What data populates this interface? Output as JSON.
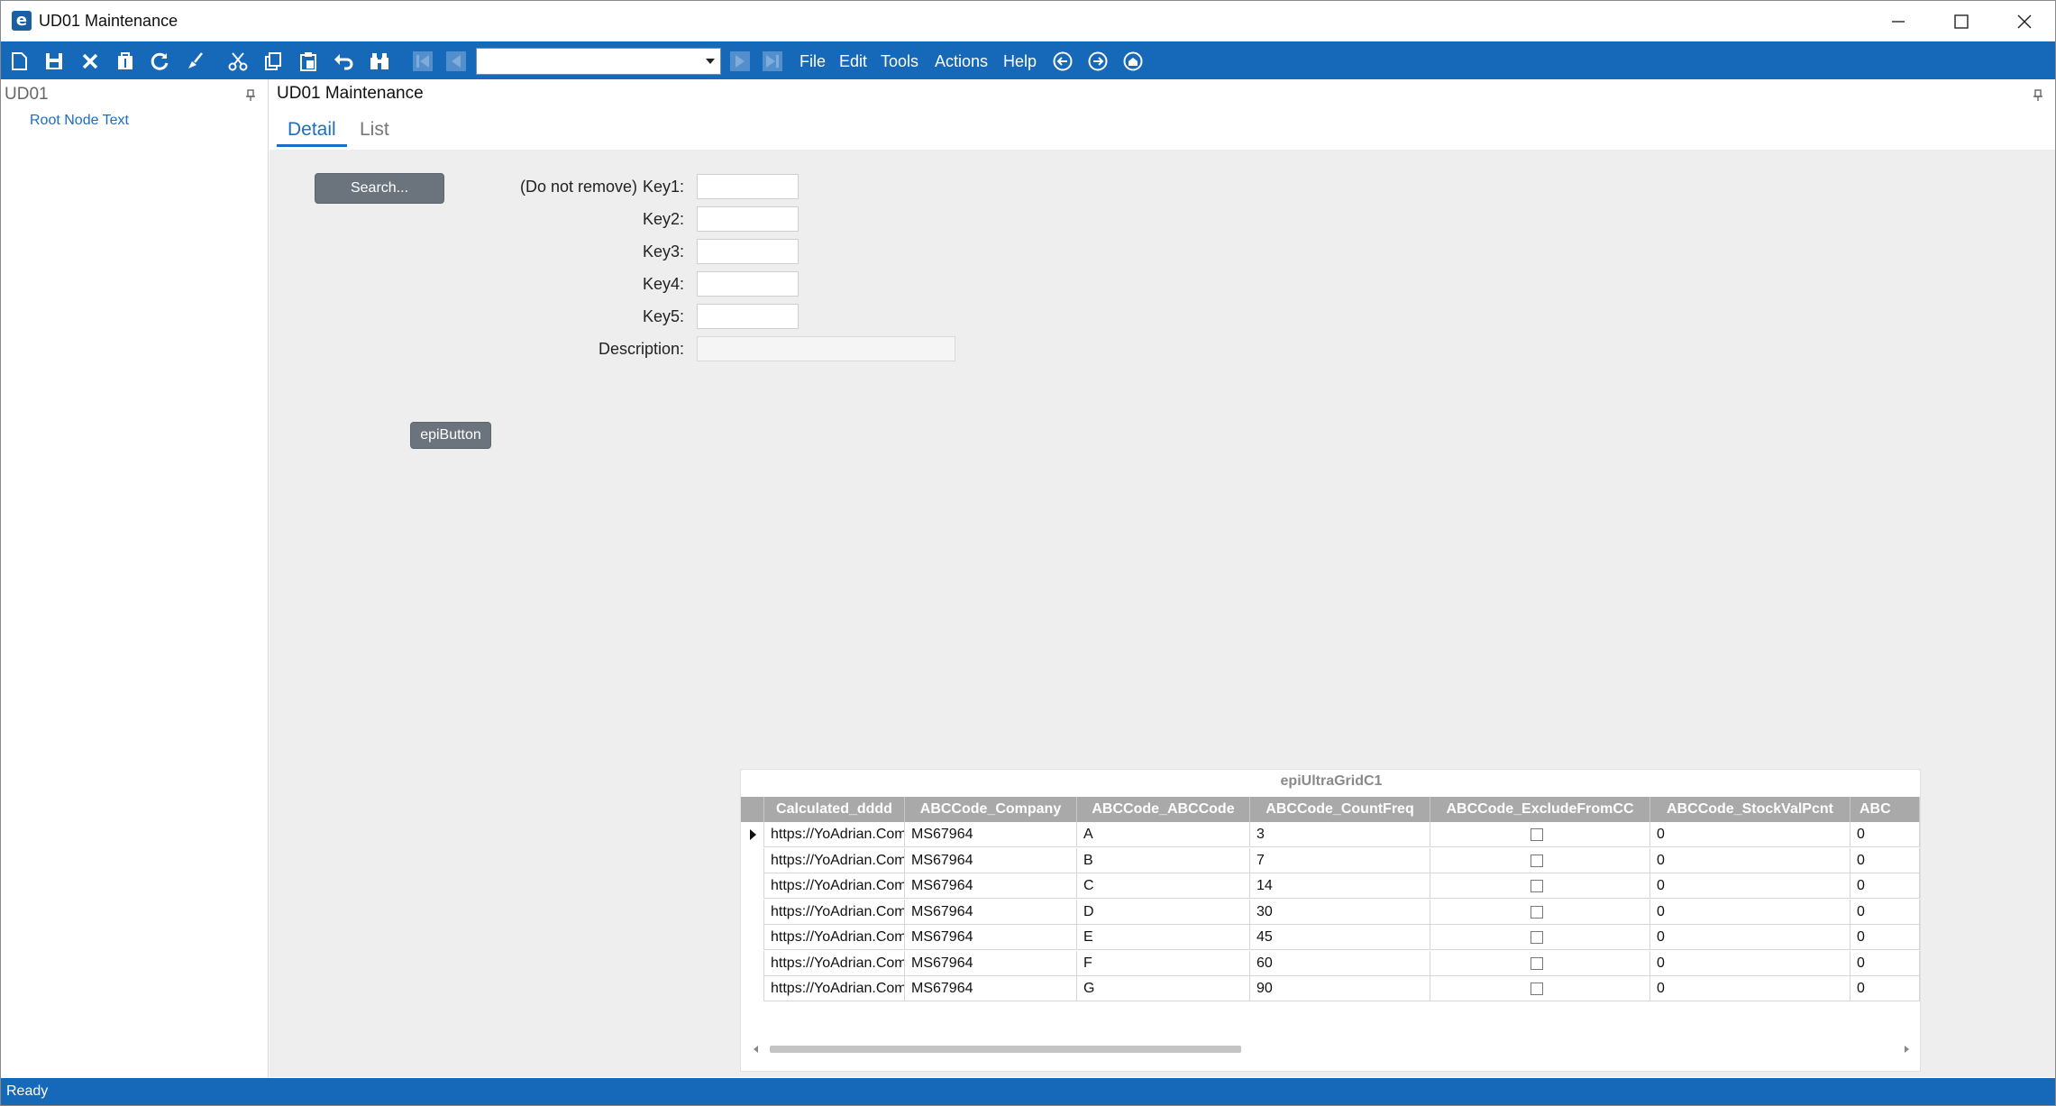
{
  "window": {
    "title": "UD01 Maintenance",
    "app_icon_letter": "e"
  },
  "toolbar": {
    "menu": [
      "File",
      "Edit",
      "Tools",
      "Actions",
      "Help"
    ],
    "nav_combo_value": ""
  },
  "left_panel": {
    "header": "UD01",
    "tree": {
      "root": "Root Node Text"
    }
  },
  "main": {
    "title": "UD01 Maintenance",
    "tabs": [
      {
        "label": "Detail",
        "active": true
      },
      {
        "label": "List",
        "active": false
      }
    ]
  },
  "form": {
    "search_button": "Search...",
    "prefix_note": "(Do not remove)",
    "fields": [
      {
        "label": "Key1:",
        "value": ""
      },
      {
        "label": "Key2:",
        "value": ""
      },
      {
        "label": "Key3:",
        "value": ""
      },
      {
        "label": "Key4:",
        "value": ""
      },
      {
        "label": "Key5:",
        "value": ""
      },
      {
        "label": "Description:",
        "value": ""
      }
    ],
    "epi_button": "epiButton"
  },
  "grid": {
    "caption": "epiUltraGridC1",
    "columns": [
      "Calculated_dddd",
      "ABCCode_Company",
      "ABCCode_ABCCode",
      "ABCCode_CountFreq",
      "ABCCode_ExcludeFromCC",
      "ABCCode_StockValPcnt",
      "ABC"
    ],
    "rows": [
      {
        "url": "https://YoAdrian.Com/",
        "company": "MS67964",
        "code": "A",
        "freq": "3",
        "exclude": false,
        "stock": "0",
        "abc": "0"
      },
      {
        "url": "https://YoAdrian.Com/",
        "company": "MS67964",
        "code": "B",
        "freq": "7",
        "exclude": false,
        "stock": "0",
        "abc": "0"
      },
      {
        "url": "https://YoAdrian.Com/",
        "company": "MS67964",
        "code": "C",
        "freq": "14",
        "exclude": false,
        "stock": "0",
        "abc": "0"
      },
      {
        "url": "https://YoAdrian.Com/",
        "company": "MS67964",
        "code": "D",
        "freq": "30",
        "exclude": false,
        "stock": "0",
        "abc": "0"
      },
      {
        "url": "https://YoAdrian.Com/",
        "company": "MS67964",
        "code": "E",
        "freq": "45",
        "exclude": false,
        "stock": "0",
        "abc": "0"
      },
      {
        "url": "https://YoAdrian.Com/",
        "company": "MS67964",
        "code": "F",
        "freq": "60",
        "exclude": false,
        "stock": "0",
        "abc": "0"
      },
      {
        "url": "https://YoAdrian.Com/",
        "company": "MS67964",
        "code": "G",
        "freq": "90",
        "exclude": false,
        "stock": "0",
        "abc": "0"
      }
    ],
    "selected_row": 0
  },
  "status": {
    "text": "Ready"
  },
  "colors": {
    "accent": "#1668b8",
    "link": "#1b6ec2",
    "grid_header": "#a9a9a9",
    "button": "#6b747c"
  }
}
